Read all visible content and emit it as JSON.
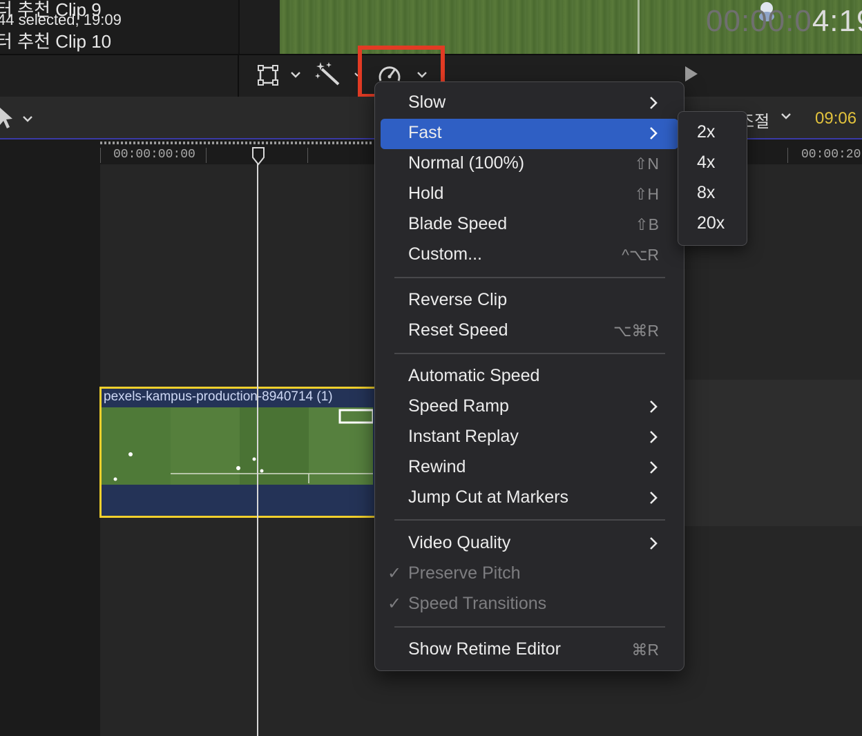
{
  "browser": {
    "clips": [
      "터 추천 Clip 9",
      "터 추천 Clip 10"
    ]
  },
  "toolbar": {
    "status": "44 selected, 19:09",
    "icons": [
      "transform-icon",
      "magic-wand-icon",
      "speedometer-icon"
    ],
    "timecode_dim": "00:00:0",
    "timecode_bright": "4:19"
  },
  "timeline_header": {
    "adjust_label": "조절",
    "duration": "09:06"
  },
  "timeline": {
    "ruler_start": "00:00:00:00",
    "ruler_end": "00:00:20",
    "clip_title": "pexels-kampus-production-8940714 (1)"
  },
  "speed_menu": {
    "items": [
      {
        "label": "Slow",
        "shortcut": "",
        "submenu": true
      },
      {
        "label": "Fast",
        "shortcut": "",
        "submenu": true,
        "selected": true
      },
      {
        "label": "Normal (100%)",
        "shortcut": "⇧N"
      },
      {
        "label": "Hold",
        "shortcut": "⇧H"
      },
      {
        "label": "Blade Speed",
        "shortcut": "⇧B"
      },
      {
        "label": "Custom...",
        "shortcut": "^⌥R"
      },
      {
        "label": "Reverse Clip",
        "shortcut": ""
      },
      {
        "label": "Reset Speed",
        "shortcut": "⌥⌘R"
      },
      {
        "label": "Automatic Speed",
        "shortcut": ""
      },
      {
        "label": "Speed Ramp",
        "shortcut": "",
        "submenu": true
      },
      {
        "label": "Instant Replay",
        "shortcut": "",
        "submenu": true
      },
      {
        "label": "Rewind",
        "shortcut": "",
        "submenu": true
      },
      {
        "label": "Jump Cut at Markers",
        "shortcut": "",
        "submenu": true
      },
      {
        "label": "Video Quality",
        "shortcut": "",
        "submenu": true
      },
      {
        "label": "Preserve Pitch",
        "checked": true,
        "disabled": true
      },
      {
        "label": "Speed Transitions",
        "checked": true,
        "disabled": true
      },
      {
        "label": "Show Retime Editor",
        "shortcut": "⌘R"
      }
    ],
    "check_mark": "✓"
  },
  "fast_submenu": {
    "items": [
      "2x",
      "4x",
      "8x",
      "20x"
    ]
  },
  "colors": {
    "highlight": "#e23b24",
    "selection": "#2f5fc4",
    "clip_border": "#f2d02c",
    "duration": "#e2c23c"
  }
}
